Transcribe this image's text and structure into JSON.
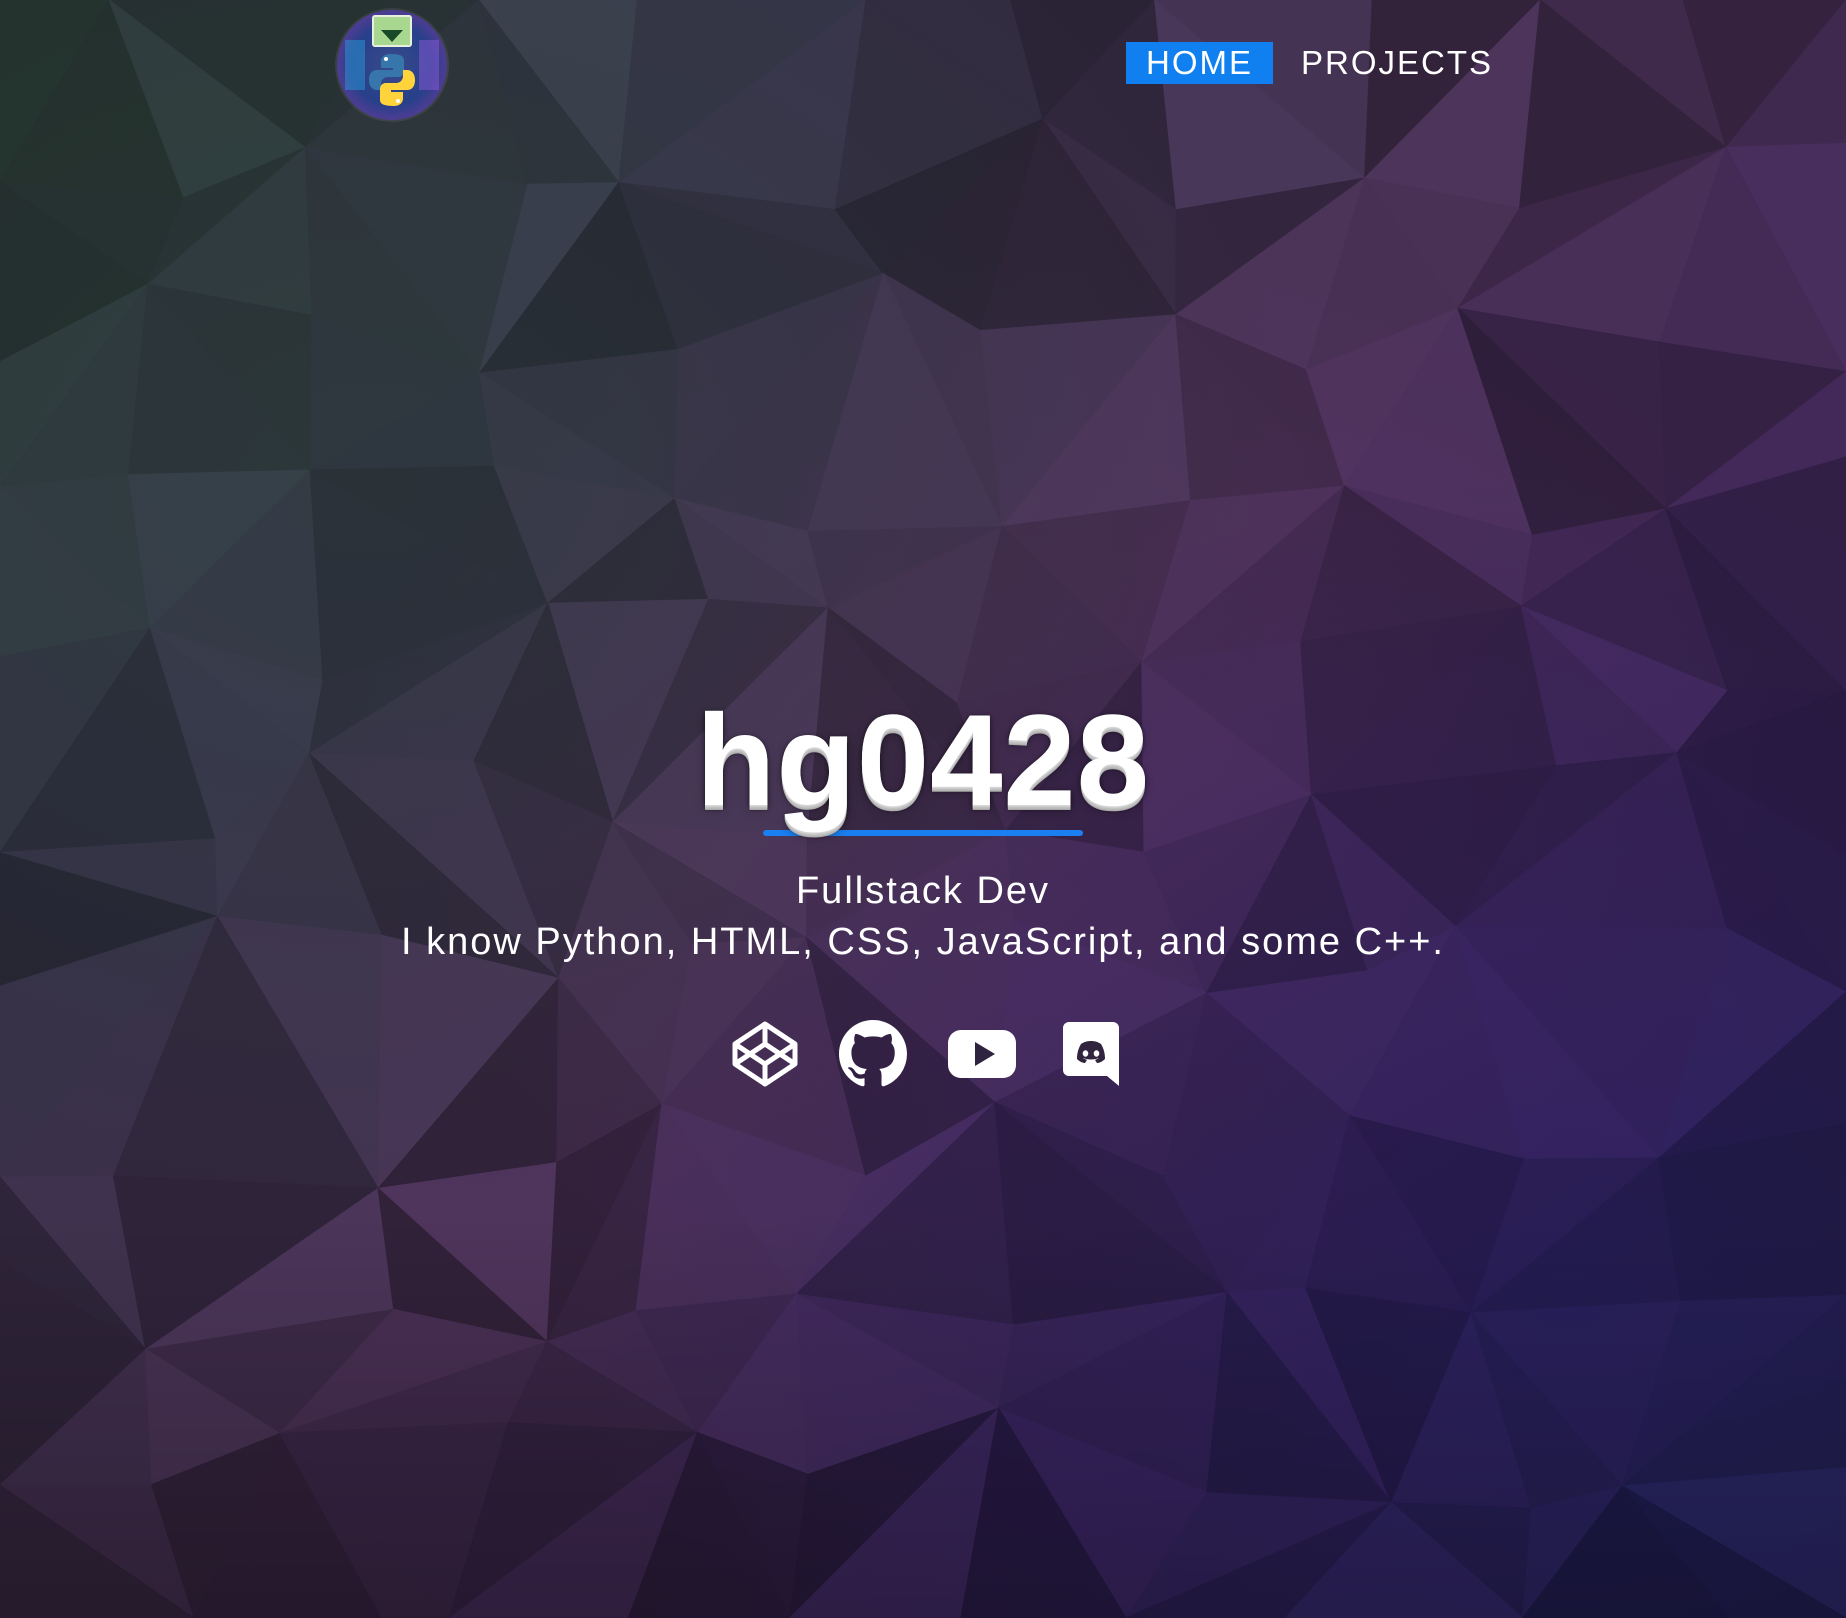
{
  "nav": {
    "avatar_icon": "python-logo-avatar-icon",
    "links": [
      {
        "label": "HOME",
        "active": true
      },
      {
        "label": "PROJECTS",
        "active": false
      }
    ],
    "active_color": "#1080f0"
  },
  "hero": {
    "title": "hg0428",
    "role": "Fullstack Dev",
    "bio": "I know Python, HTML, CSS, JavaScript, and some C++.",
    "underline_color": "#1a7ff0"
  },
  "socials": [
    {
      "icon": "codepen-icon"
    },
    {
      "icon": "github-icon"
    },
    {
      "icon": "youtube-icon"
    },
    {
      "icon": "discord-icon"
    }
  ]
}
